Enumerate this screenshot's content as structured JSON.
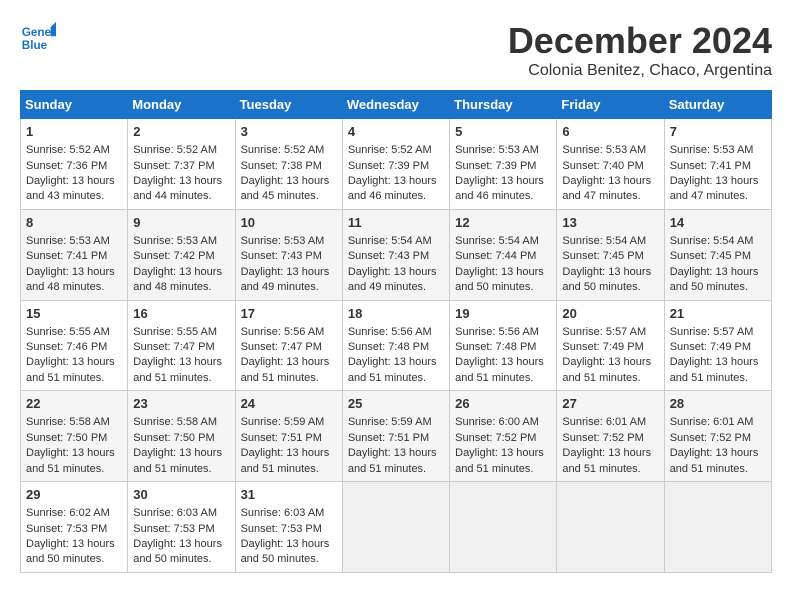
{
  "logo": {
    "line1": "General",
    "line2": "Blue"
  },
  "title": "December 2024",
  "location": "Colonia Benitez, Chaco, Argentina",
  "headers": [
    "Sunday",
    "Monday",
    "Tuesday",
    "Wednesday",
    "Thursday",
    "Friday",
    "Saturday"
  ],
  "weeks": [
    [
      {
        "day": "1",
        "rise": "5:52 AM",
        "set": "7:36 PM",
        "daylight": "13 hours and 43 minutes."
      },
      {
        "day": "2",
        "rise": "5:52 AM",
        "set": "7:37 PM",
        "daylight": "13 hours and 44 minutes."
      },
      {
        "day": "3",
        "rise": "5:52 AM",
        "set": "7:38 PM",
        "daylight": "13 hours and 45 minutes."
      },
      {
        "day": "4",
        "rise": "5:52 AM",
        "set": "7:39 PM",
        "daylight": "13 hours and 46 minutes."
      },
      {
        "day": "5",
        "rise": "5:53 AM",
        "set": "7:39 PM",
        "daylight": "13 hours and 46 minutes."
      },
      {
        "day": "6",
        "rise": "5:53 AM",
        "set": "7:40 PM",
        "daylight": "13 hours and 47 minutes."
      },
      {
        "day": "7",
        "rise": "5:53 AM",
        "set": "7:41 PM",
        "daylight": "13 hours and 47 minutes."
      }
    ],
    [
      {
        "day": "8",
        "rise": "5:53 AM",
        "set": "7:41 PM",
        "daylight": "13 hours and 48 minutes."
      },
      {
        "day": "9",
        "rise": "5:53 AM",
        "set": "7:42 PM",
        "daylight": "13 hours and 48 minutes."
      },
      {
        "day": "10",
        "rise": "5:53 AM",
        "set": "7:43 PM",
        "daylight": "13 hours and 49 minutes."
      },
      {
        "day": "11",
        "rise": "5:54 AM",
        "set": "7:43 PM",
        "daylight": "13 hours and 49 minutes."
      },
      {
        "day": "12",
        "rise": "5:54 AM",
        "set": "7:44 PM",
        "daylight": "13 hours and 50 minutes."
      },
      {
        "day": "13",
        "rise": "5:54 AM",
        "set": "7:45 PM",
        "daylight": "13 hours and 50 minutes."
      },
      {
        "day": "14",
        "rise": "5:54 AM",
        "set": "7:45 PM",
        "daylight": "13 hours and 50 minutes."
      }
    ],
    [
      {
        "day": "15",
        "rise": "5:55 AM",
        "set": "7:46 PM",
        "daylight": "13 hours and 51 minutes."
      },
      {
        "day": "16",
        "rise": "5:55 AM",
        "set": "7:47 PM",
        "daylight": "13 hours and 51 minutes."
      },
      {
        "day": "17",
        "rise": "5:56 AM",
        "set": "7:47 PM",
        "daylight": "13 hours and 51 minutes."
      },
      {
        "day": "18",
        "rise": "5:56 AM",
        "set": "7:48 PM",
        "daylight": "13 hours and 51 minutes."
      },
      {
        "day": "19",
        "rise": "5:56 AM",
        "set": "7:48 PM",
        "daylight": "13 hours and 51 minutes."
      },
      {
        "day": "20",
        "rise": "5:57 AM",
        "set": "7:49 PM",
        "daylight": "13 hours and 51 minutes."
      },
      {
        "day": "21",
        "rise": "5:57 AM",
        "set": "7:49 PM",
        "daylight": "13 hours and 51 minutes."
      }
    ],
    [
      {
        "day": "22",
        "rise": "5:58 AM",
        "set": "7:50 PM",
        "daylight": "13 hours and 51 minutes."
      },
      {
        "day": "23",
        "rise": "5:58 AM",
        "set": "7:50 PM",
        "daylight": "13 hours and 51 minutes."
      },
      {
        "day": "24",
        "rise": "5:59 AM",
        "set": "7:51 PM",
        "daylight": "13 hours and 51 minutes."
      },
      {
        "day": "25",
        "rise": "5:59 AM",
        "set": "7:51 PM",
        "daylight": "13 hours and 51 minutes."
      },
      {
        "day": "26",
        "rise": "6:00 AM",
        "set": "7:52 PM",
        "daylight": "13 hours and 51 minutes."
      },
      {
        "day": "27",
        "rise": "6:01 AM",
        "set": "7:52 PM",
        "daylight": "13 hours and 51 minutes."
      },
      {
        "day": "28",
        "rise": "6:01 AM",
        "set": "7:52 PM",
        "daylight": "13 hours and 51 minutes."
      }
    ],
    [
      {
        "day": "29",
        "rise": "6:02 AM",
        "set": "7:53 PM",
        "daylight": "13 hours and 50 minutes."
      },
      {
        "day": "30",
        "rise": "6:03 AM",
        "set": "7:53 PM",
        "daylight": "13 hours and 50 minutes."
      },
      {
        "day": "31",
        "rise": "6:03 AM",
        "set": "7:53 PM",
        "daylight": "13 hours and 50 minutes."
      },
      null,
      null,
      null,
      null
    ]
  ],
  "labels": {
    "sunrise": "Sunrise:",
    "sunset": "Sunset:",
    "daylight": "Daylight:"
  }
}
